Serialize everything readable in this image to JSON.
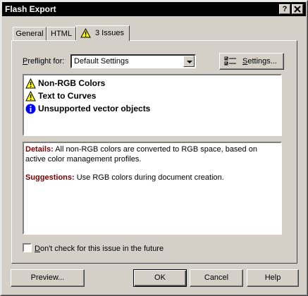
{
  "window": {
    "title": "Flash Export",
    "help_button": "?",
    "close_button": "X"
  },
  "tabs": [
    {
      "label": "General"
    },
    {
      "label": "HTML"
    },
    {
      "label": "3 Issues",
      "icon": "warning-icon",
      "active": true
    }
  ],
  "preflight": {
    "label_prefix": "",
    "label_underlined": "P",
    "label_rest": "reflight for:",
    "selected": "Default Settings",
    "settings_prefix": "",
    "settings_underlined": "S",
    "settings_rest": "ettings..."
  },
  "issues": [
    {
      "icon": "warning-icon",
      "label": "Non-RGB Colors"
    },
    {
      "icon": "warning-icon",
      "label": "Text to Curves"
    },
    {
      "icon": "info-icon",
      "label": "Unsupported vector objects"
    }
  ],
  "details": {
    "details_label": "Details:",
    "details_text": "All non-RGB colors are converted to RGB space, based on active color management profiles.",
    "suggestions_label": "Suggestions:",
    "suggestions_text": "Use RGB colors during document creation."
  },
  "checkbox": {
    "label_underlined": "D",
    "label_rest": "on't check for this issue in the future",
    "checked": false
  },
  "buttons": {
    "preview": "Preview...",
    "ok": "OK",
    "cancel": "Cancel",
    "help": "Help"
  },
  "colors": {
    "title_bar": "#000000",
    "face": "#d4d0c8",
    "detail_label": "#800000",
    "warning": "#ffff00",
    "info": "#0000ff"
  }
}
